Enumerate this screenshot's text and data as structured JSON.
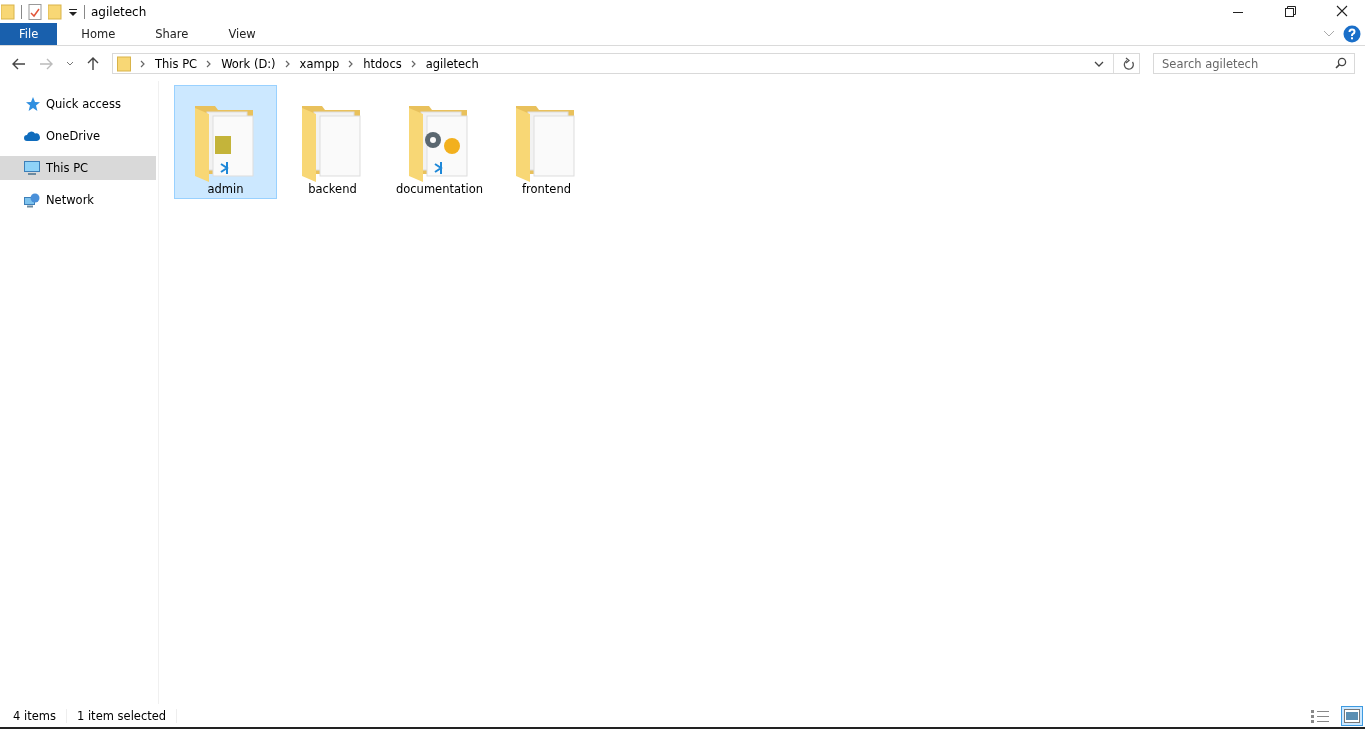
{
  "window": {
    "title": "agiletech"
  },
  "ribbon_tabs": [
    {
      "label": "File",
      "kind": "file",
      "selected": false
    },
    {
      "label": "Home",
      "kind": "tab",
      "selected": false
    },
    {
      "label": "Share",
      "kind": "tab",
      "selected": false
    },
    {
      "label": "View",
      "kind": "tab",
      "selected": false
    }
  ],
  "breadcrumb": [
    "This PC",
    "Work (D:)",
    "xampp",
    "htdocs",
    "agiletech"
  ],
  "search": {
    "placeholder": "Search agiletech"
  },
  "sidebar": {
    "items": [
      {
        "label": "Quick access",
        "kind": "star",
        "selected": false
      },
      {
        "label": "OneDrive",
        "kind": "cloud",
        "selected": false
      },
      {
        "label": "This PC",
        "kind": "pc",
        "selected": true
      },
      {
        "label": "Network",
        "kind": "network",
        "selected": false
      }
    ]
  },
  "folders": [
    {
      "name": "admin",
      "kind": "js",
      "selected": true
    },
    {
      "name": "backend",
      "kind": "plain",
      "selected": false
    },
    {
      "name": "documentation",
      "kind": "gear",
      "selected": false
    },
    {
      "name": "frontend",
      "kind": "plain",
      "selected": false
    }
  ],
  "status_bar": {
    "count": "4 items",
    "selection": "1 item selected"
  },
  "views": [
    {
      "kind": "details",
      "selected": false
    },
    {
      "kind": "large",
      "selected": true
    }
  ]
}
